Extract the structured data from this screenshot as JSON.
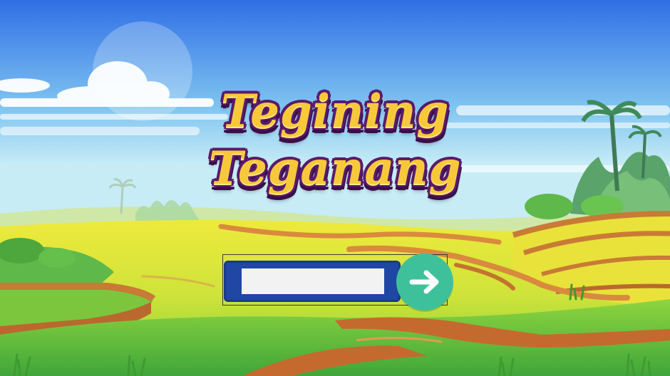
{
  "game": {
    "title_line1": "Tegining",
    "title_line2": "Teganang"
  },
  "form": {
    "name_input": {
      "value": "",
      "placeholder": ""
    },
    "submit_icon": "arrow-right-icon"
  },
  "colors": {
    "title_fill": "#f7c93a",
    "title_outline": "#5a1a6b",
    "panel": "#1f47a3",
    "button": "#3ec19a"
  }
}
